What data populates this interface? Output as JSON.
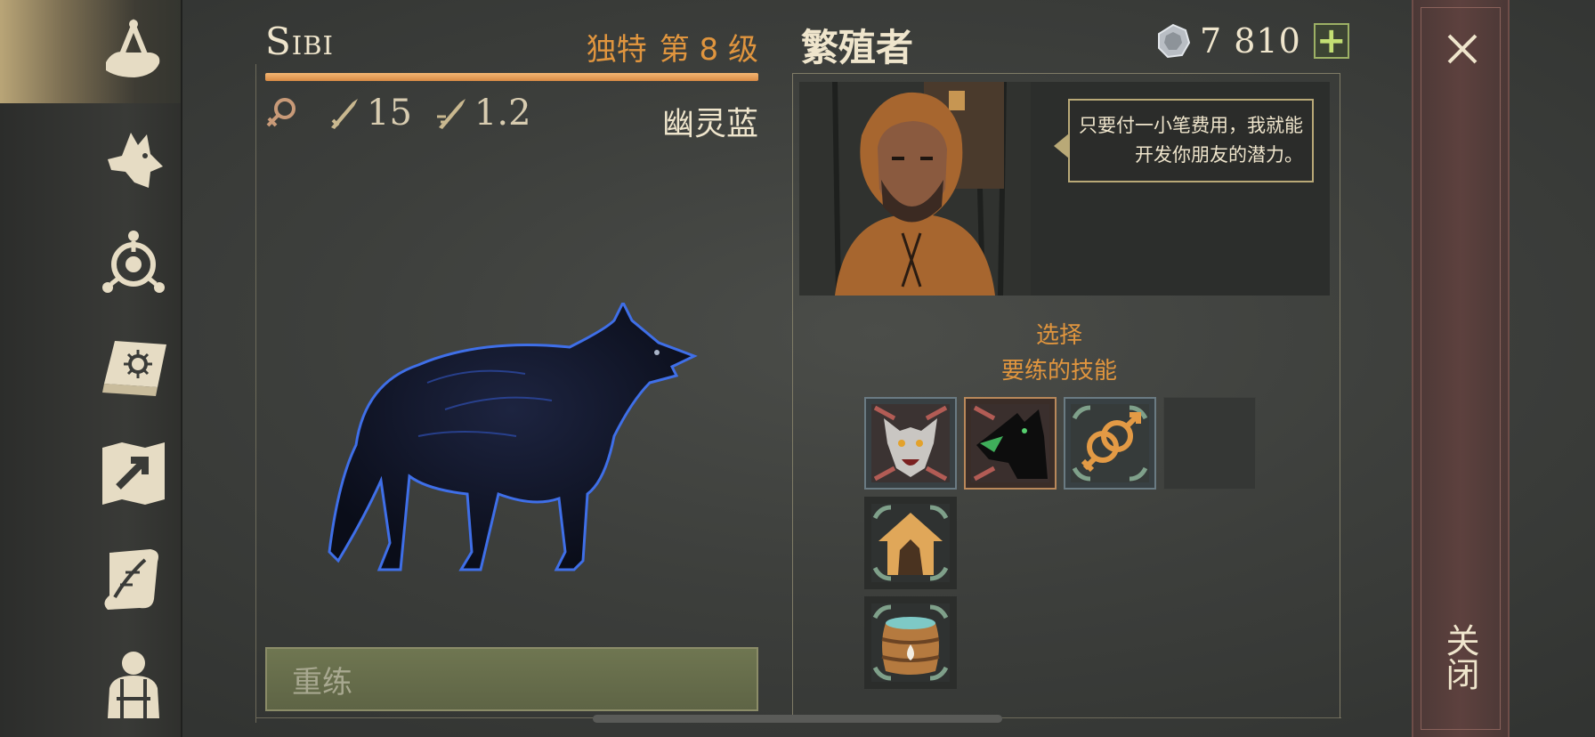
{
  "sidebar": {
    "items": [
      {
        "icon": "totem-hand-icon",
        "active": true
      },
      {
        "icon": "wolf-head-icon",
        "active": false
      },
      {
        "icon": "skill-tree-icon",
        "active": false
      },
      {
        "icon": "book-icon",
        "active": false
      },
      {
        "icon": "map-arrow-icon",
        "active": false
      },
      {
        "icon": "scroll-icon",
        "active": false
      },
      {
        "icon": "character-icon",
        "active": false
      }
    ]
  },
  "wolf": {
    "name": "Sibi",
    "rarity": "独特",
    "level": "第 8 级",
    "xp_progress": 1.0,
    "gender_icon": "female-icon",
    "attack": "15",
    "speed": "1.2",
    "coat_name": "幽灵蓝",
    "retrain_label": "重练"
  },
  "breeder": {
    "title": "繁殖者",
    "currency_icon": "silver-coin-icon",
    "currency_value": "7 810",
    "add_label": "+",
    "speech": "只要付一小笔费用，我就能开发你朋友的潜力。",
    "select_line1": "选择",
    "select_line2": "要练的技能"
  },
  "skills": [
    {
      "icon": "wolf-face-skill-icon",
      "empty": false
    },
    {
      "icon": "snarling-wolf-skill-icon",
      "empty": false
    },
    {
      "icon": "gender-symbols-skill-icon",
      "empty": false
    },
    {
      "icon": "",
      "empty": true
    },
    {
      "icon": "den-house-skill-icon",
      "empty": false
    },
    {
      "icon": "water-barrel-skill-icon",
      "empty": false
    }
  ],
  "close": {
    "label": "关闭",
    "icon": "close-icon"
  },
  "colors": {
    "accent_orange": "#e0953e",
    "panel_text": "#efe5cc",
    "retrain_green": "#6f7651",
    "close_red": "#5d413e"
  }
}
